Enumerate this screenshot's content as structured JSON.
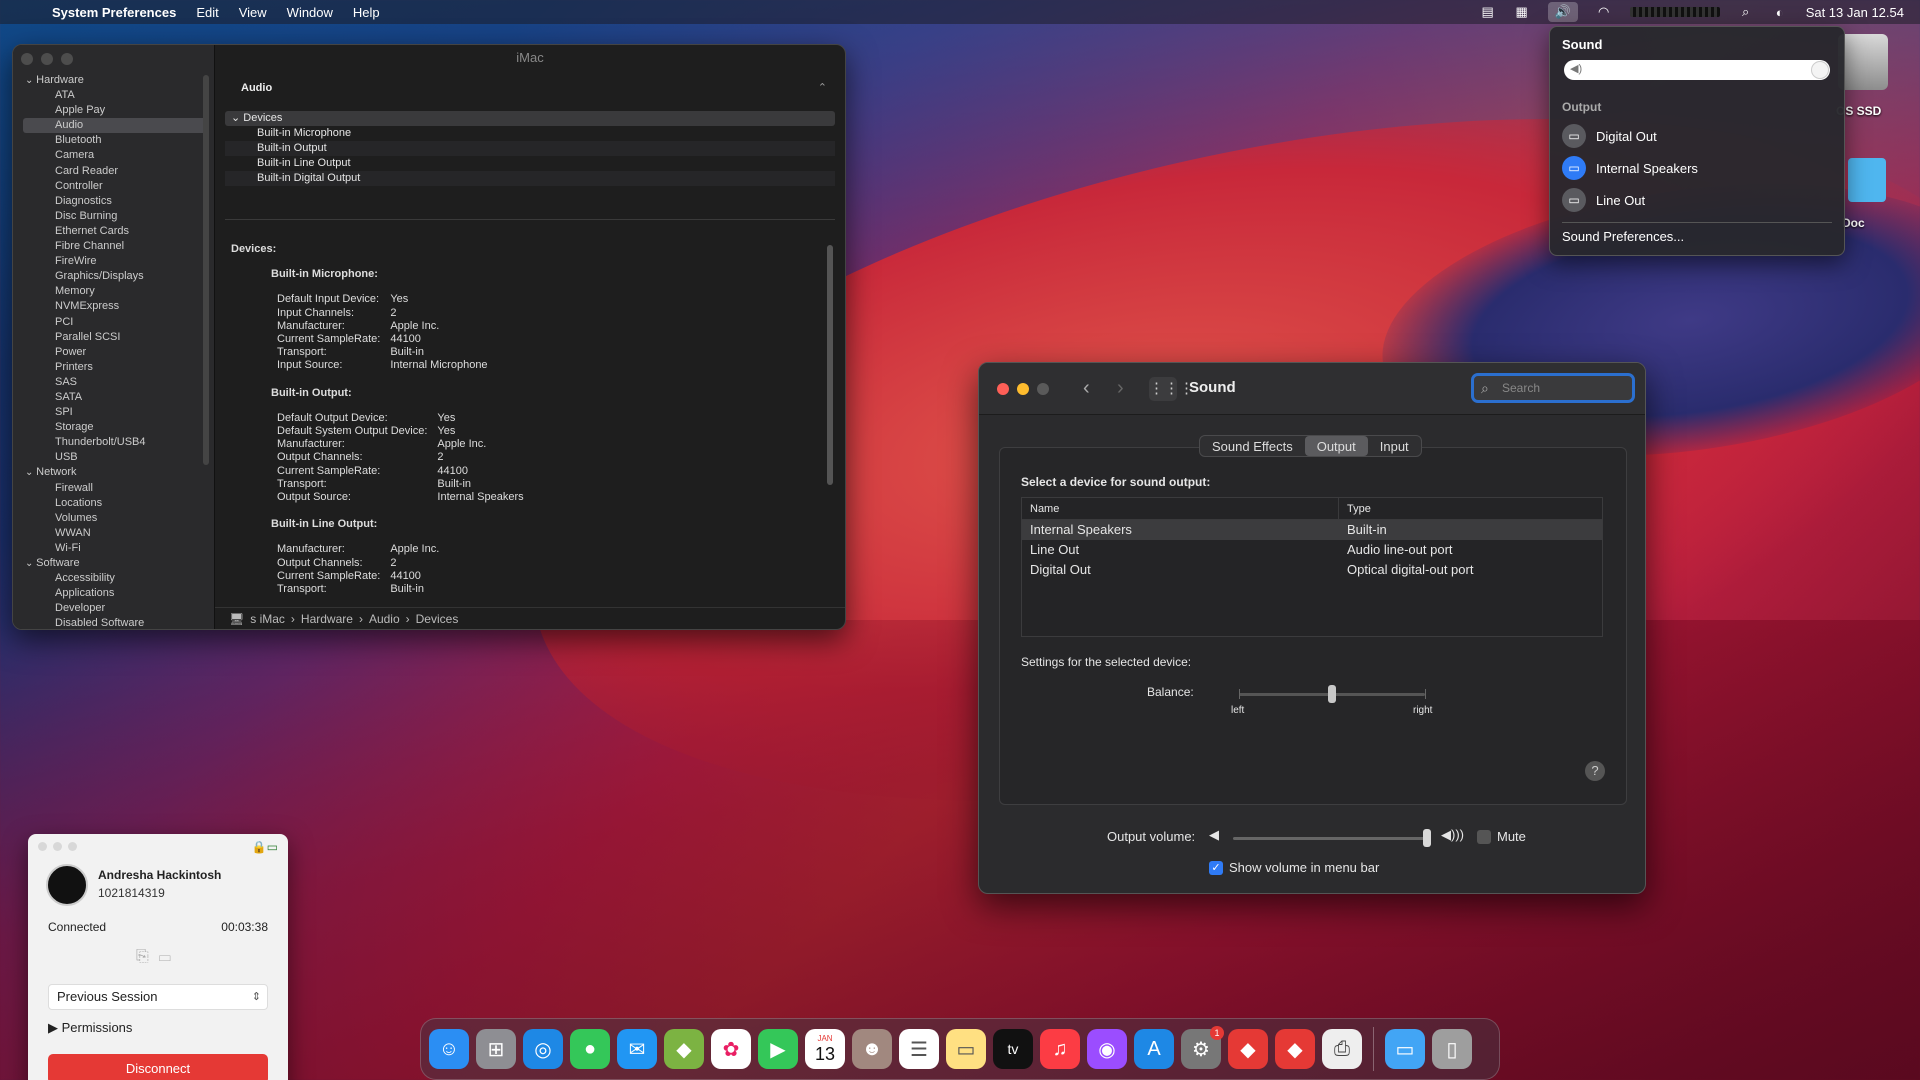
{
  "menubar": {
    "app_name": "System Preferences",
    "menus": [
      "Edit",
      "View",
      "Window",
      "Help"
    ],
    "datetime": "Sat 13 Jan  12.54"
  },
  "desktop": {
    "ssd_label": "OS SSD",
    "doc_label": "Doc"
  },
  "volume_menu": {
    "title": "Sound",
    "volume_level": 1.0,
    "output_header": "Output",
    "devices": [
      {
        "label": "Digital Out",
        "selected": false
      },
      {
        "label": "Internal Speakers",
        "selected": true
      },
      {
        "label": "Line Out",
        "selected": false
      }
    ],
    "preferences_label": "Sound Preferences..."
  },
  "sysinfo": {
    "window_title": "iMac",
    "tree": [
      {
        "label": "Hardware",
        "type": "group"
      },
      {
        "label": "ATA",
        "type": "item"
      },
      {
        "label": "Apple Pay",
        "type": "item"
      },
      {
        "label": "Audio",
        "type": "item",
        "selected": true
      },
      {
        "label": "Bluetooth",
        "type": "item"
      },
      {
        "label": "Camera",
        "type": "item"
      },
      {
        "label": "Card Reader",
        "type": "item"
      },
      {
        "label": "Controller",
        "type": "item"
      },
      {
        "label": "Diagnostics",
        "type": "item"
      },
      {
        "label": "Disc Burning",
        "type": "item"
      },
      {
        "label": "Ethernet Cards",
        "type": "item"
      },
      {
        "label": "Fibre Channel",
        "type": "item"
      },
      {
        "label": "FireWire",
        "type": "item"
      },
      {
        "label": "Graphics/Displays",
        "type": "item"
      },
      {
        "label": "Memory",
        "type": "item"
      },
      {
        "label": "NVMExpress",
        "type": "item"
      },
      {
        "label": "PCI",
        "type": "item"
      },
      {
        "label": "Parallel SCSI",
        "type": "item"
      },
      {
        "label": "Power",
        "type": "item"
      },
      {
        "label": "Printers",
        "type": "item"
      },
      {
        "label": "SAS",
        "type": "item"
      },
      {
        "label": "SATA",
        "type": "item"
      },
      {
        "label": "SPI",
        "type": "item"
      },
      {
        "label": "Storage",
        "type": "item"
      },
      {
        "label": "Thunderbolt/USB4",
        "type": "item"
      },
      {
        "label": "USB",
        "type": "item"
      },
      {
        "label": "Network",
        "type": "group"
      },
      {
        "label": "Firewall",
        "type": "item"
      },
      {
        "label": "Locations",
        "type": "item"
      },
      {
        "label": "Volumes",
        "type": "item"
      },
      {
        "label": "WWAN",
        "type": "item"
      },
      {
        "label": "Wi-Fi",
        "type": "item"
      },
      {
        "label": "Software",
        "type": "group"
      },
      {
        "label": "Accessibility",
        "type": "item"
      },
      {
        "label": "Applications",
        "type": "item"
      },
      {
        "label": "Developer",
        "type": "item"
      },
      {
        "label": "Disabled Software",
        "type": "item"
      }
    ],
    "table_header": "Audio",
    "list": [
      {
        "label": "Devices",
        "header": true
      },
      {
        "label": "Built-in Microphone"
      },
      {
        "label": "Built-in Output"
      },
      {
        "label": "Built-in Line Output"
      },
      {
        "label": "Built-in Digital Output"
      }
    ],
    "detail_title": "Devices:",
    "detail_sections": [
      {
        "title": "Built-in Microphone:",
        "rows": [
          [
            "Default Input Device:",
            "Yes"
          ],
          [
            "Input Channels:",
            "2"
          ],
          [
            "Manufacturer:",
            "Apple Inc."
          ],
          [
            "Current SampleRate:",
            "44100"
          ],
          [
            "Transport:",
            "Built-in"
          ],
          [
            "Input Source:",
            "Internal Microphone"
          ]
        ]
      },
      {
        "title": "Built-in Output:",
        "rows": [
          [
            "Default Output Device:",
            "Yes"
          ],
          [
            "Default System Output Device:",
            "Yes"
          ],
          [
            "Manufacturer:",
            "Apple Inc."
          ],
          [
            "Output Channels:",
            "2"
          ],
          [
            "Current SampleRate:",
            "44100"
          ],
          [
            "Transport:",
            "Built-in"
          ],
          [
            "Output Source:",
            "Internal Speakers"
          ]
        ]
      },
      {
        "title": "Built-in Line Output:",
        "rows": [
          [
            "Manufacturer:",
            "Apple Inc."
          ],
          [
            "Output Channels:",
            "2"
          ],
          [
            "Current SampleRate:",
            "44100"
          ],
          [
            "Transport:",
            "Built-in"
          ]
        ]
      }
    ],
    "path": [
      "s iMac",
      "Hardware",
      "Audio",
      "Devices"
    ]
  },
  "sound_prefs": {
    "title": "Sound",
    "search_placeholder": "Search",
    "tabs": [
      {
        "label": "Sound Effects",
        "active": false
      },
      {
        "label": "Output",
        "active": true
      },
      {
        "label": "Input",
        "active": false
      }
    ],
    "select_device_label": "Select a device for sound output:",
    "columns": [
      "Name",
      "Type"
    ],
    "devices": [
      {
        "name": "Internal Speakers",
        "type": "Built-in",
        "selected": true
      },
      {
        "name": "Line Out",
        "type": "Audio line-out port",
        "selected": false
      },
      {
        "name": "Digital Out",
        "type": "Optical digital-out port",
        "selected": false
      }
    ],
    "settings_label": "Settings for the selected device:",
    "balance_label": "Balance:",
    "balance_left": "left",
    "balance_right": "right",
    "balance_value": 0.5,
    "output_volume_label": "Output volume:",
    "output_volume_value": 1.0,
    "mute_label": "Mute",
    "mute_checked": false,
    "show_volume_label": "Show volume in menu bar",
    "show_volume_checked": true,
    "help": "?"
  },
  "session": {
    "name": "Andresha Hackintosh",
    "id": "1021814319",
    "status": "Connected",
    "duration": "00:03:38",
    "session_select": "Previous Session",
    "permissions_label": "Permissions",
    "disconnect_label": "Disconnect"
  },
  "dock": {
    "calendar_month": "JAN",
    "calendar_day": "13",
    "appletv_label": "tv",
    "settings_badge": "1"
  },
  "colors": {
    "accent": "#2f7bf6",
    "disconnect": "#e53935"
  }
}
